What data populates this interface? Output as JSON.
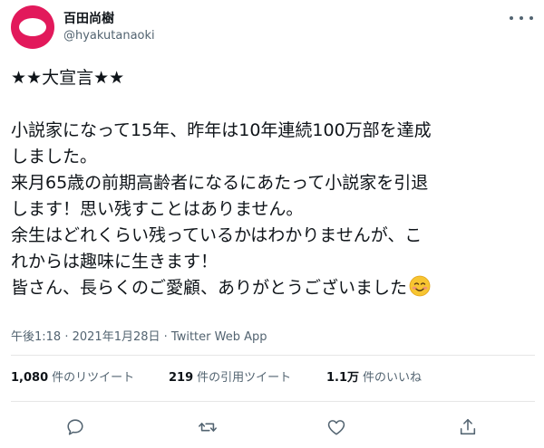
{
  "user": {
    "display_name": "百田尚樹",
    "handle": "@hyakutanaoki",
    "avatar_color": "#e2195b"
  },
  "tweet": {
    "lines": [
      "★★大宣言★★",
      "",
      "小説家になって15年、昨年は10年連続100万部を達成",
      "しました。",
      "来月65歳の前期高齢者になるにあたって小説家を引退",
      "します！思い残すことはありません。",
      "余生はどれくらい残っているかはわかりませんが、こ",
      "れからは趣味に生きます！",
      "皆さん、長らくのご愛顧、ありがとうございました"
    ],
    "emoji": "smiling-face-with-blush-emoji"
  },
  "meta": {
    "time": "午後1:18",
    "separator": " · ",
    "date": "2021年1月28日",
    "source": "Twitter Web App"
  },
  "stats": {
    "retweets": {
      "count": "1,080",
      "label": "件のリツイート"
    },
    "quotes": {
      "count": "219",
      "label": "件の引用ツイート"
    },
    "likes": {
      "count": "1.1万",
      "label": "件のいいね"
    }
  },
  "actions": [
    "reply-icon",
    "retweet-icon",
    "like-icon",
    "share-icon"
  ],
  "colors": {
    "text": "#0f1419",
    "secondary": "#536471",
    "divider": "#e6e6e6"
  }
}
